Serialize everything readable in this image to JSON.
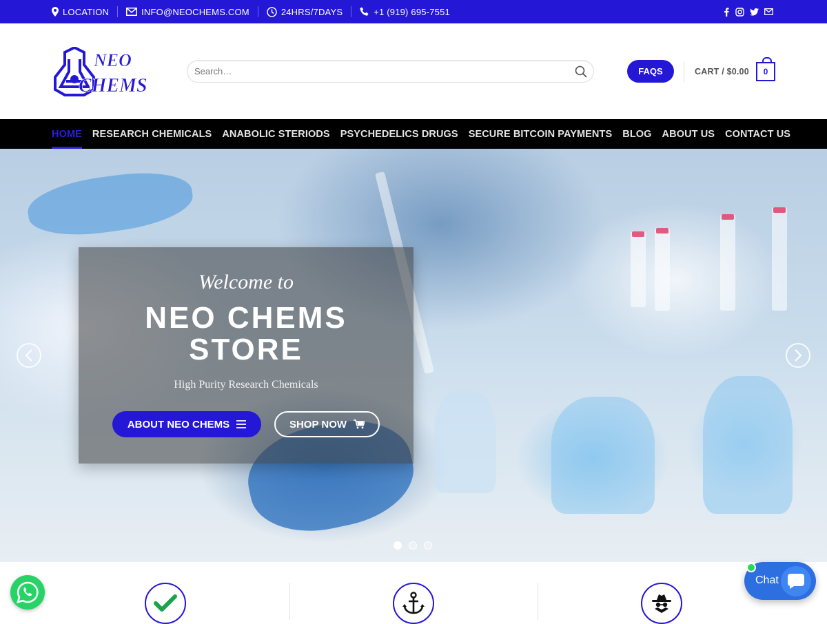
{
  "topbar": {
    "location": "LOCATION",
    "email": "INFO@NEOCHEMS.COM",
    "hours": "24HRS/7DAYS",
    "phone": "+1 (919) 695-7551",
    "social_icons": [
      "facebook-icon",
      "instagram-icon",
      "twitter-icon",
      "envelope-icon"
    ]
  },
  "header": {
    "logo_text_line1": "NEO",
    "logo_text_line2": "CHEMS",
    "search_placeholder": "Search…",
    "faqs_label": "FAQS",
    "cart_label": "CART /",
    "cart_total": "$0.00",
    "cart_count": "0"
  },
  "nav": {
    "items": [
      {
        "label": "HOME",
        "active": true
      },
      {
        "label": "RESEARCH CHEMICALS"
      },
      {
        "label": "ANABOLIC STERIODS"
      },
      {
        "label": "PSYCHEDELICS DRUGS"
      },
      {
        "label": "SECURE BITCOIN PAYMENTS"
      },
      {
        "label": "BLOG"
      },
      {
        "label": "ABOUT US"
      },
      {
        "label": "CONTACT US"
      }
    ]
  },
  "hero": {
    "welcome": "Welcome to",
    "title": "NEO CHEMS STORE",
    "subtitle": "High Purity Research Chemicals",
    "about_button": "ABOUT NEO CHEMS",
    "shop_button": "SHOP NOW",
    "slide_count": 3,
    "active_slide": 1
  },
  "features": {
    "icons": [
      "checkmark-icon",
      "anchor-icon",
      "spy-icon"
    ]
  },
  "floating": {
    "chat_label": "Chat"
  },
  "colors": {
    "brand": "#2417d6",
    "nav_bg": "#000000",
    "whatsapp": "#25d366",
    "chat": "#2d6fe0"
  }
}
